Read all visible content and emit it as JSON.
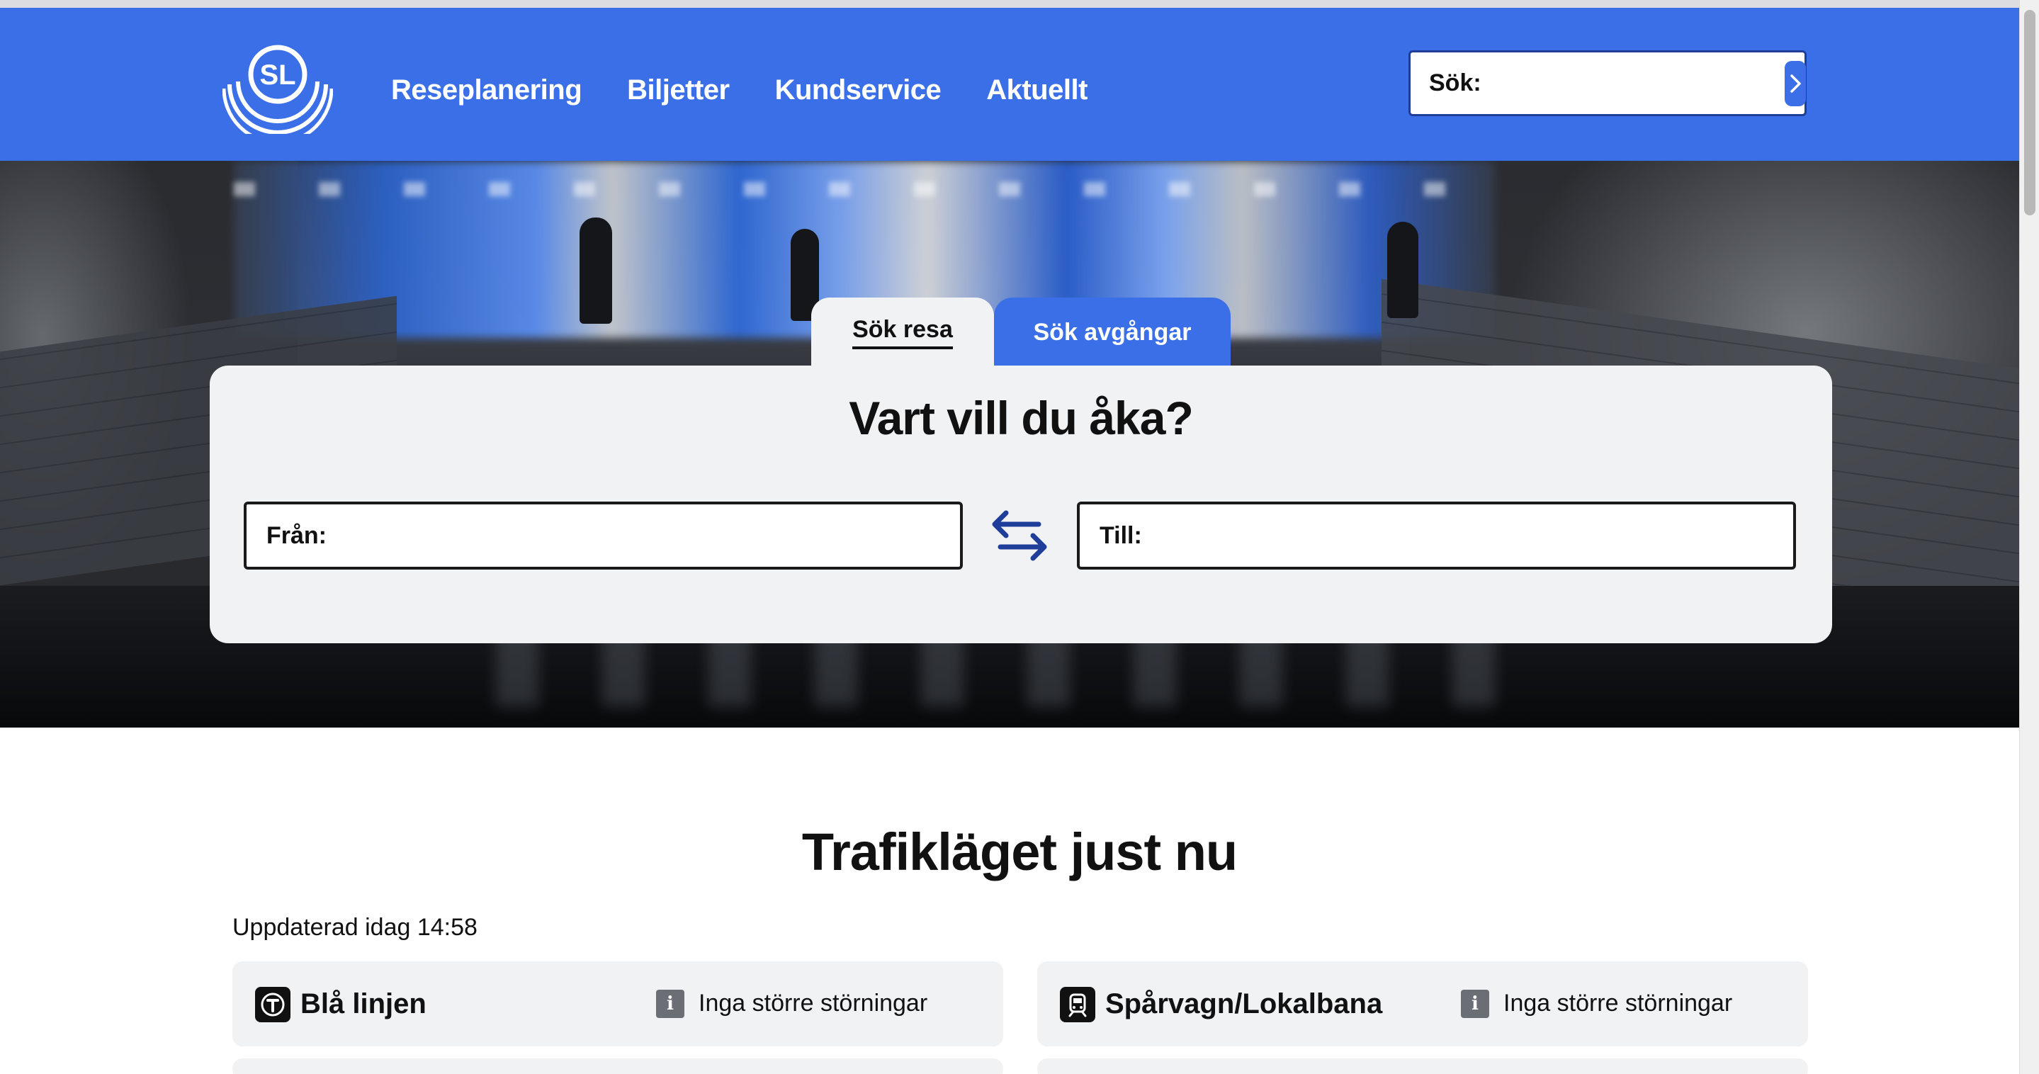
{
  "header": {
    "logo_text": "SL",
    "nav": [
      "Reseplanering",
      "Biljetter",
      "Kundservice",
      "Aktuellt"
    ],
    "search_label": "Sök:",
    "search_value": ""
  },
  "planner": {
    "tabs": [
      "Sök resa",
      "Sök avgångar"
    ],
    "active_tab": "Sök resa",
    "heading": "Vart vill du åka?",
    "from_label": "Från:",
    "from_value": "",
    "to_label": "Till:",
    "to_value": ""
  },
  "traffic": {
    "title": "Trafikläget just nu",
    "updated": "Uppdaterad idag 14:58",
    "lines": [
      {
        "name": "Blå linjen",
        "icon": "metro-icon",
        "status": "Inga större störningar"
      },
      {
        "name": "Spårvagn/Lokalbana",
        "icon": "tram-icon",
        "status": "Inga större störningar"
      }
    ]
  },
  "colors": {
    "brand_blue": "#3b6fe8",
    "panel_gray": "#f1f2f4",
    "dark_blue_icon": "#1f3e99"
  }
}
